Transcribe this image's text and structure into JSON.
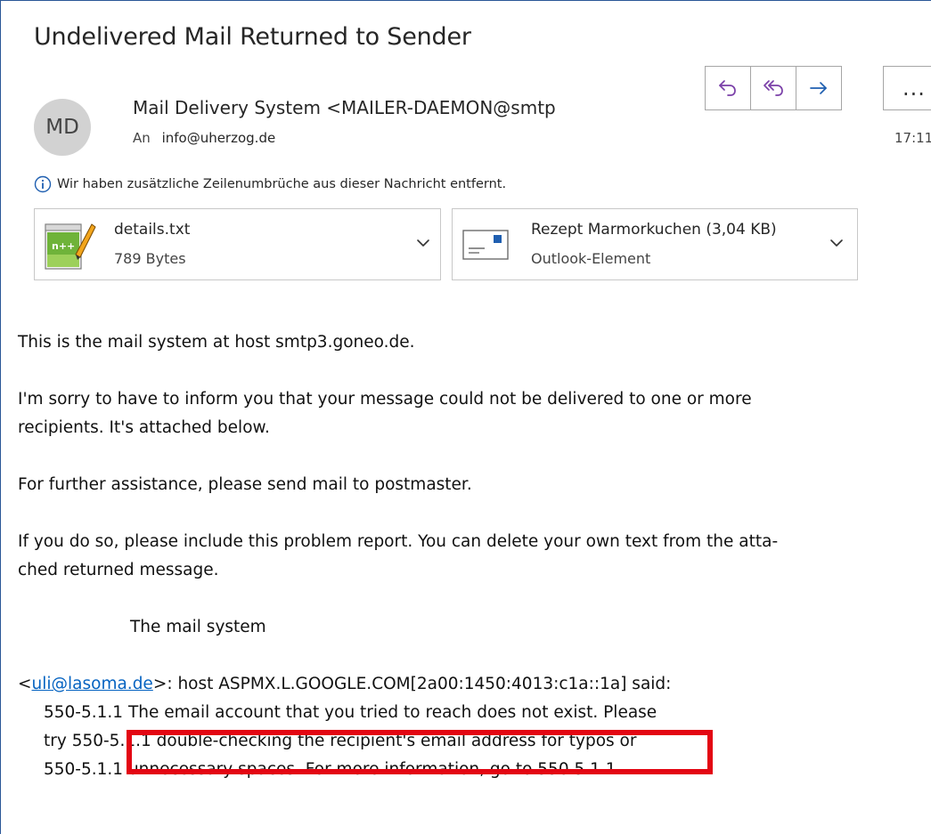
{
  "message": {
    "subject": "Undelivered Mail Returned to Sender",
    "sender": {
      "initials": "MD",
      "display": "Mail Delivery System <MAILER-DAEMON@smtp"
    },
    "to_label": "An",
    "to_address": "info@uherzog.de",
    "time": "17:11"
  },
  "actions": {
    "reply_icon": "reply-icon",
    "reply_all_icon": "reply-all-icon",
    "forward_icon": "forward-icon",
    "more_label": "..."
  },
  "info_bar": {
    "icon": "info-icon",
    "text": "Wir haben zusätzliche Zeilenumbrüche aus dieser Nachricht entfernt."
  },
  "attachments": [
    {
      "name": "details.txt",
      "meta": "789 Bytes",
      "icon": "notepad-plus-plus-icon"
    },
    {
      "name": "Rezept Marmorkuchen (3,04 KB)",
      "meta": "Outlook-Element",
      "icon": "envelope-icon"
    }
  ],
  "body": {
    "p1": "This is the mail system at host smtp3.goneo.de.",
    "p2_l1": "I'm sorry to have to inform you that your message could not be delivered to one or more",
    "p2_l2": "recipients. It's attached below.",
    "p3": "For further assistance, please send mail to postmaster.",
    "p4_l1": "If you do so, please include this problem report. You can delete your own text from the atta-",
    "p4_l2": "ched returned message.",
    "signature": "The mail system",
    "bounce_open": "<",
    "bounce_link": "uli@lasoma.de",
    "bounce_rest": ">: host ASPMX.L.GOOGLE.COM[2a00:1450:4013:c1a::1a] said:",
    "err_l1_prefix": "550-5.1.1",
    "err_l1_highlight": "The email account that you tried to reach does not exist.",
    "err_l1_suffix": "Please",
    "err_l2": "try 550-5.1.1 double-checking the recipient's email address for typos or",
    "err_l3": "550-5.1.1 unnecessary spaces. For more information, go to 550 5.1.1"
  },
  "colors": {
    "highlight_border": "#e30613",
    "link": "#0563c1",
    "frame_border": "#2b5797"
  }
}
